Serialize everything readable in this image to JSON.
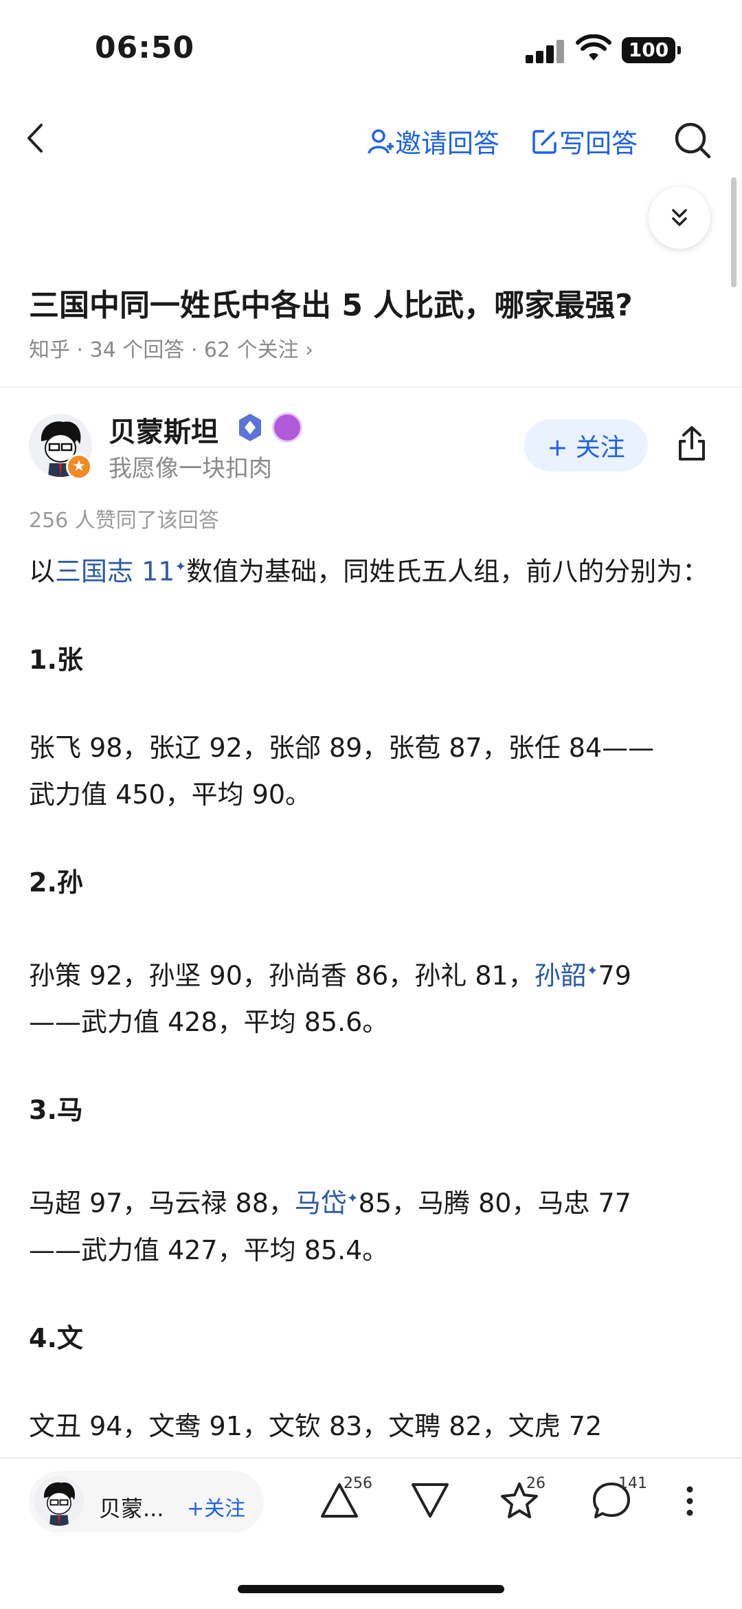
{
  "status_bar": {
    "time": "06:50",
    "battery": "100"
  },
  "nav": {
    "invite_label": "邀请回答",
    "write_label": "写回答"
  },
  "question": {
    "title": "三国中同一姓氏中各出 5 人比武，哪家最强?",
    "meta": "知乎 · 34 个回答 · 62 个关注 ›"
  },
  "author": {
    "name": "贝蒙斯坦",
    "bio": "我愿像一块扣肉",
    "follow_label": "+ 关注"
  },
  "answer": {
    "likes_line": "256 人赞同了该回答",
    "intro_prefix": "以",
    "intro_link": "三国志 11",
    "intro_rest": "数值为基础，同姓氏五人组，前八的分别为：",
    "sections": [
      {
        "heading": "1.张",
        "line1": "张飞 98，张辽 92，张郃 89，张苞 87，张任 84——",
        "line2": "武力值 450，平均 90。"
      },
      {
        "heading": "2.孙",
        "line1_prefix": "孙策 92，孙坚 90，孙尚香 86，孙礼 81，",
        "line1_link": "孙韶",
        "line1_suffix": "79",
        "line2": "——武力值 428，平均 85.6。"
      },
      {
        "heading": "3.马",
        "line1_prefix": "马超 97，马云禄 88，",
        "line1_link": "马岱",
        "line1_suffix": "85，马腾 80，马忠 77",
        "line2": "——武力值 427，平均 85.4。"
      },
      {
        "heading": "4.文",
        "line1": "文丑 94，文鸯 91，文钦 83，文聘 82，文虎 72"
      }
    ]
  },
  "bottom_bar": {
    "author_short": "贝蒙...",
    "follow_label": "+关注",
    "upvote_count": "256",
    "favorite_count": "26",
    "comment_count": "141"
  }
}
